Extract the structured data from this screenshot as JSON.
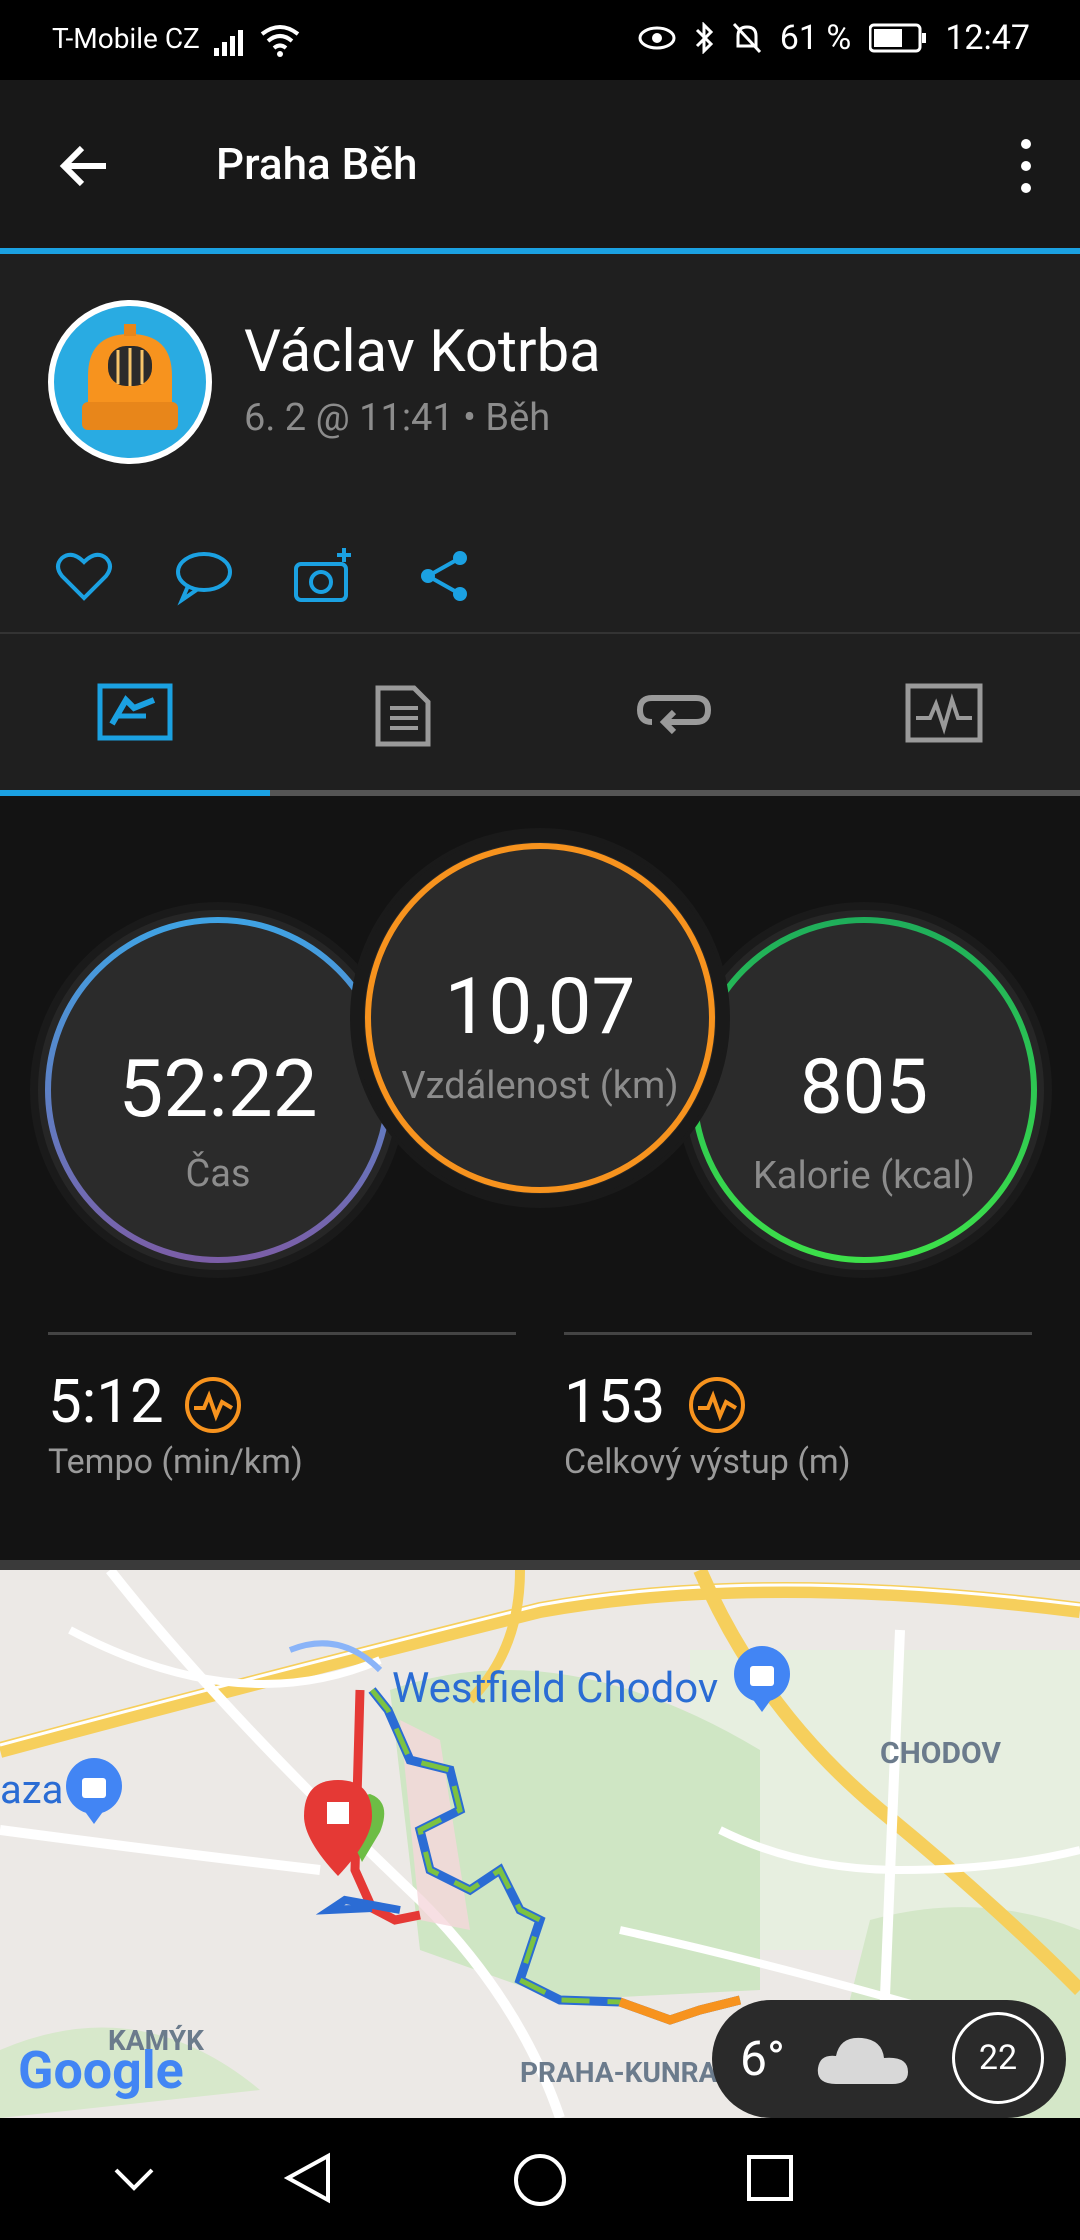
{
  "status_bar": {
    "carrier": "T-Mobile CZ",
    "battery": "61 %",
    "time": "12:47"
  },
  "app_bar": {
    "title": "Praha Běh"
  },
  "profile": {
    "name": "Václav Kotrba",
    "meta": "6. 2 @ 11:41 • Běh"
  },
  "stats": {
    "time_value": "52:22",
    "time_label": "Čas",
    "distance_value": "10,07",
    "distance_label": "Vzdálenost (km)",
    "calories_value": "805",
    "calories_label": "Kalorie (kcal)",
    "pace_value": "5:12",
    "pace_label": "Tempo (min/km)",
    "ascent_value": "153",
    "ascent_label": "Celkový výstup (m)"
  },
  "map": {
    "labels": {
      "westfield": "Westfield Chodov",
      "chodov": "CHODOV",
      "plaza_partial": "aza",
      "kamyk": "KAMÝK",
      "kunratice": "PRAHA-KUNRAT",
      "google": "Google"
    }
  },
  "weather": {
    "temp": "6°",
    "aqi": "22"
  },
  "colors": {
    "accent": "#1ba1e2",
    "orange": "#f7931e",
    "green": "#39d353",
    "blue": "#3f9ae0",
    "purple": "#7b5ea7"
  }
}
